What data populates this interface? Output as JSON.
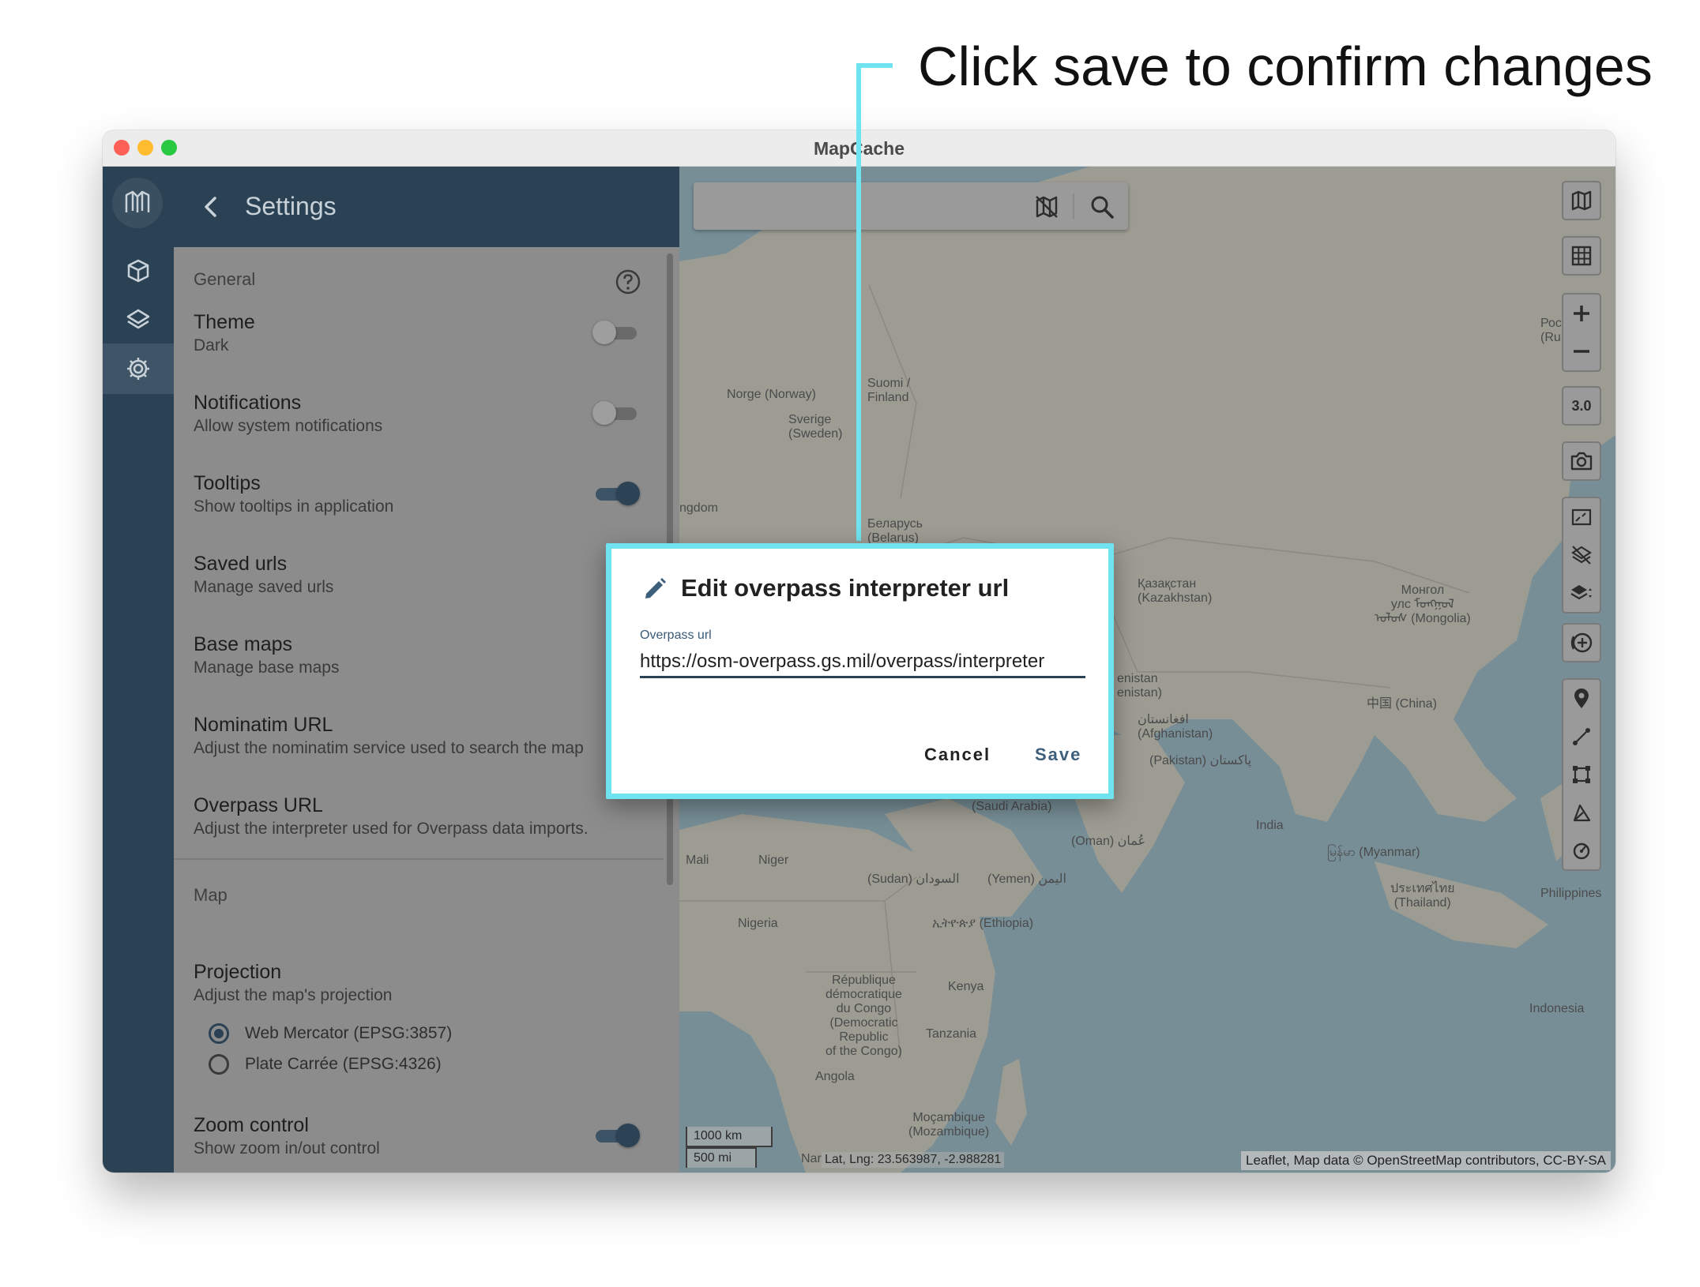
{
  "annotation": {
    "text": "Click save to confirm changes"
  },
  "window": {
    "title": "MapCache"
  },
  "rail": {
    "items": [
      {
        "name": "logo",
        "icon": "map-logo-icon"
      },
      {
        "name": "geopackages",
        "icon": "cube-icon"
      },
      {
        "name": "layers",
        "icon": "layers-icon"
      },
      {
        "name": "settings",
        "icon": "gear-icon",
        "active": true
      }
    ]
  },
  "settings": {
    "title": "Settings",
    "general_label": "General",
    "items": [
      {
        "title": "Theme",
        "subtitle": "Dark",
        "toggle": false
      },
      {
        "title": "Notifications",
        "subtitle": "Allow system notifications",
        "toggle": false
      },
      {
        "title": "Tooltips",
        "subtitle": "Show tooltips in application",
        "toggle": true
      },
      {
        "title": "Saved urls",
        "subtitle": "Manage saved urls"
      },
      {
        "title": "Base maps",
        "subtitle": "Manage base maps"
      },
      {
        "title": "Nominatim URL",
        "subtitle": "Adjust the nominatim service used to search the map"
      },
      {
        "title": "Overpass URL",
        "subtitle": "Adjust the interpreter used for Overpass data imports."
      }
    ],
    "map_label": "Map",
    "projection": {
      "title": "Projection",
      "subtitle": "Adjust the map's projection",
      "options": [
        {
          "label": "Web Mercator (EPSG:3857)",
          "selected": true
        },
        {
          "label": "Plate Carrée (EPSG:4326)",
          "selected": false
        }
      ]
    },
    "zoom_control": {
      "title": "Zoom control",
      "subtitle": "Show zoom in/out control",
      "toggle": true
    }
  },
  "map": {
    "zoom_level": "3.0",
    "labels": {
      "norway": "Norge (Norway)",
      "finland": "Suomi /\nFinland",
      "sweden": "Sverige\n(Sweden)",
      "kingdom": "ngdom",
      "belarus": "Беларусь\n(Belarus)",
      "russia": "Россия\n(Ru",
      "kazakhstan": "Қазақстан\n(Kazakhstan)",
      "mongolia": "Монгол\nулс ᠮᠣᠩᠭᠣᠯ\nᠤᠯᠤᠰ (Mongolia)",
      "turkmenistan": "enistan\nenistan)",
      "afghanistan": "افغانستان\n(Afghanistan)",
      "pakistan": "(Pakistan) پاکستان",
      "china": "中国 (China)",
      "saudi": "السعودية\n(Saudi Arabia)",
      "oman": "(Oman) عُمان",
      "india": "India",
      "myanmar": "မြန်မာ (Myanmar)",
      "thailand": "ประเทศไทย\n(Thailand)",
      "philippines": "Philippines",
      "mali": "Mali",
      "niger": "Niger",
      "sudan": "(Sudan) السودان",
      "yemen": "(Yemen) اليمن",
      "nigeria": "Nigeria",
      "ethiopia": "ኢትዮጵያ (Ethiopia)",
      "drc": "République\ndémocratique\ndu Congo\n(Democratic\nRepublic\nof the Congo)",
      "kenya": "Kenya",
      "tanzania": "Tanzania",
      "indonesia": "Indonesia",
      "angola": "Angola",
      "mozambique": "Moçambique\n(Mozambique)",
      "namibia": "Nar"
    },
    "scale_km": "1000 km",
    "scale_mi": "500 mi",
    "latlng": "Lat, Lng: 23.563987, -2.988281",
    "attribution": "Leaflet, Map data © OpenStreetMap contributors, CC-BY-SA"
  },
  "dialog": {
    "title": "Edit overpass interpreter url",
    "field_label": "Overpass url",
    "field_value": "https://osm-overpass.gs.mil/overpass/interpreter",
    "cancel_label": "Cancel",
    "save_label": "Save"
  },
  "colors": {
    "accent": "#6fe3ef",
    "rail": "#2b4254",
    "save": "#3e5f7c"
  }
}
